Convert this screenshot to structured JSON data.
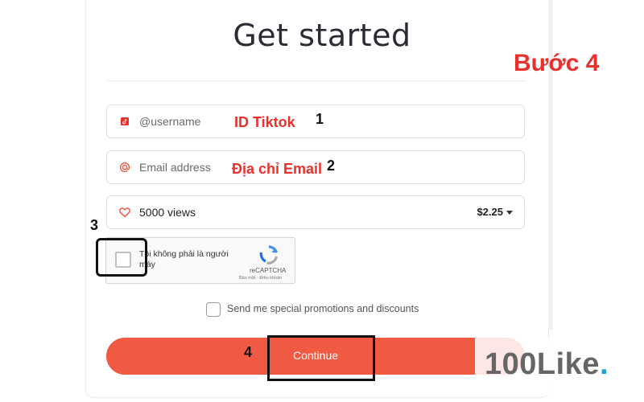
{
  "page": {
    "title": "Get started",
    "step_label": "Bước 4"
  },
  "form": {
    "username": {
      "placeholder": "@username",
      "annotation": "ID Tiktok",
      "step": "1"
    },
    "email": {
      "placeholder": "Email address",
      "annotation": "Địa chỉ Email",
      "step": "2"
    },
    "package": {
      "views": "5000 views",
      "price": "$2.25"
    },
    "captcha": {
      "step": "3",
      "label": "Tôi không phải là người máy",
      "brand": "reCAPTCHA",
      "terms": "Bảo mật - Điều khoản"
    },
    "promotions": {
      "label": "Send me special promotions and discounts",
      "checked": false
    },
    "continue": {
      "label": "Continue",
      "step": "4"
    }
  },
  "watermark": {
    "text": "100Like",
    "dot": "."
  },
  "colors": {
    "accent": "#f05a42",
    "annotation_red": "#e8312c",
    "watermark_dot": "#1aa3d6"
  },
  "icons": {
    "username": "tiktok-icon",
    "email": "at-sign-icon",
    "views": "heart-icon",
    "captcha": "recaptcha-logo-icon"
  }
}
